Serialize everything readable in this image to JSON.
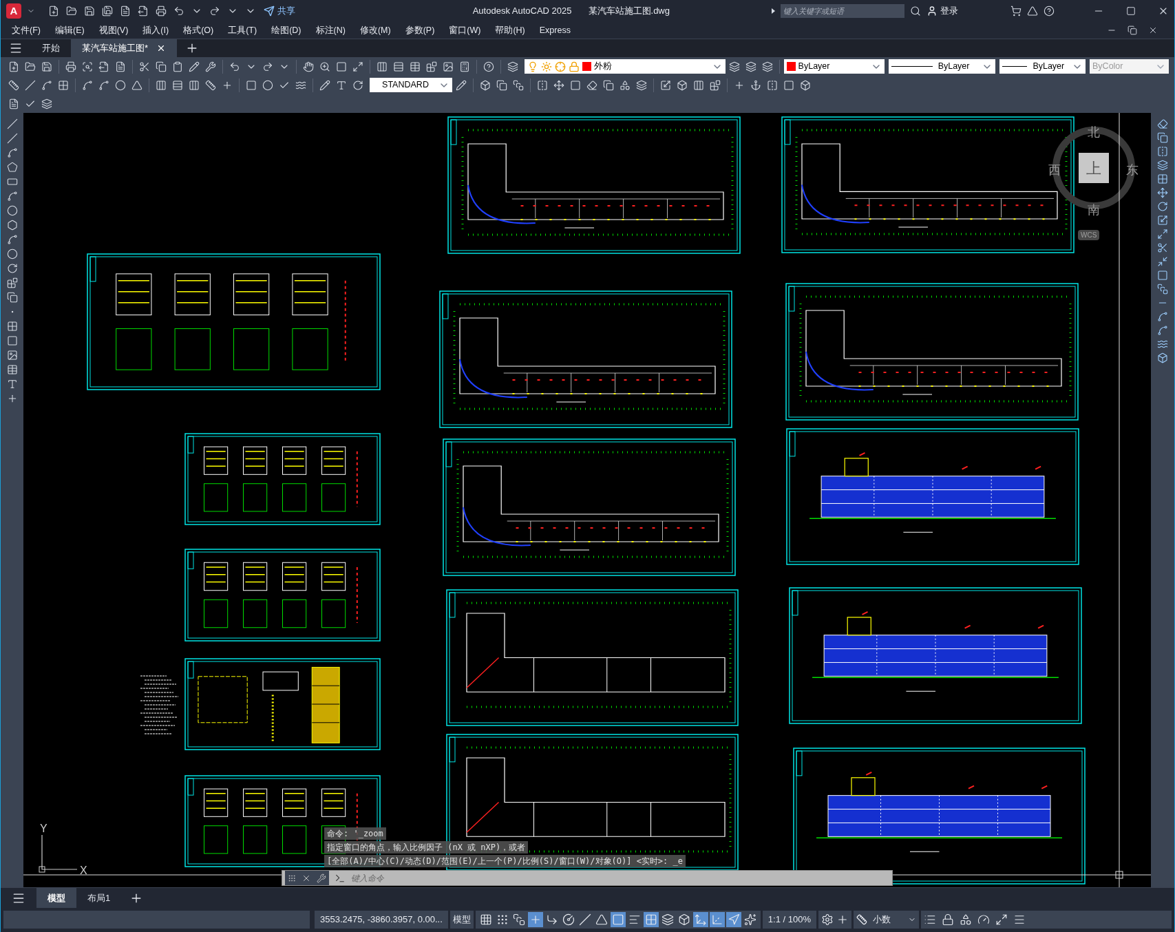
{
  "title_bar": {
    "logo_letter": "A",
    "share": "共享",
    "title": "Autodesk AutoCAD 2025",
    "filename": "某汽车站施工图.dwg",
    "search": {
      "placeholder": "键入关键字或短语"
    },
    "sign_in": "登录"
  },
  "menu": [
    "文件(F)",
    "编辑(E)",
    "视图(V)",
    "插入(I)",
    "格式(O)",
    "工具(T)",
    "绘图(D)",
    "标注(N)",
    "修改(M)",
    "参数(P)",
    "窗口(W)",
    "帮助(H)",
    "Express"
  ],
  "file_tabs": [
    {
      "label": "开始",
      "selected": false
    },
    {
      "label": "某汽车站施工图*",
      "selected": true
    }
  ],
  "properties": {
    "layer": "外粉",
    "color_setting": "ByLayer",
    "linetype": "ByLayer",
    "lineweight": "ByLayer",
    "plot_style": "ByColor",
    "plot_style_disabled": true
  },
  "text_style": "STANDARD",
  "sheets": [
    {
      "kind": "plan"
    },
    {
      "kind": "plan"
    },
    {
      "kind": "details"
    },
    {
      "kind": "plan"
    },
    {
      "kind": "plan"
    },
    {
      "kind": "details"
    },
    {
      "kind": "plan"
    },
    {
      "kind": "elevation"
    },
    {
      "kind": "details"
    },
    {
      "kind": "outline"
    },
    {
      "kind": "elevation"
    },
    {
      "kind": "schedule"
    },
    {
      "kind": "outline"
    },
    {
      "kind": "elevation"
    },
    {
      "kind": "details"
    }
  ],
  "viewcube": {
    "north": "北",
    "west": "西",
    "east": "东",
    "south": "南",
    "face": "上",
    "ucs": "WCS"
  },
  "ucs_icon": {
    "y": "Y",
    "x": "X"
  },
  "command_history": [
    "命令: '_zoom",
    "指定窗口的角点，输入比例因子 (nX 或 nXP)，或者",
    "[全部(A)/中心(C)/动态(D)/范围(E)/上一个(P)/比例(S)/窗口(W)/对象(O)] <实时>: _e"
  ],
  "command_line": {
    "placeholder": "键入命令"
  },
  "layout_tabs": [
    {
      "label": "模型",
      "selected": true
    },
    {
      "label": "布局1",
      "selected": false
    }
  ],
  "status_bar": {
    "coordinates": "3553.2475, -3860.3957, 0.00...",
    "space": "模型",
    "toggles": [
      {
        "kind": "grid",
        "on": false
      },
      {
        "kind": "snap",
        "on": false
      },
      {
        "kind": "infer",
        "on": false
      },
      {
        "kind": "dynamic",
        "on": true
      },
      {
        "kind": "ortho",
        "on": false
      },
      {
        "kind": "polar",
        "on": false
      },
      {
        "kind": "isodraft",
        "on": false
      },
      {
        "kind": "angle",
        "on": false
      },
      {
        "kind": "osnap",
        "on": true
      },
      {
        "kind": "lineweight",
        "on": false
      },
      {
        "kind": "transparency",
        "on": true
      },
      {
        "kind": "selection",
        "on": false
      },
      {
        "kind": "osnap3d",
        "on": false
      },
      {
        "kind": "tracking",
        "on": true
      },
      {
        "kind": "gizmo",
        "on": true
      },
      {
        "kind": "annovis",
        "on": true
      },
      {
        "kind": "autoscale",
        "on": false
      }
    ],
    "annotation_scale": "1:1 / 100%",
    "units": "小数"
  }
}
